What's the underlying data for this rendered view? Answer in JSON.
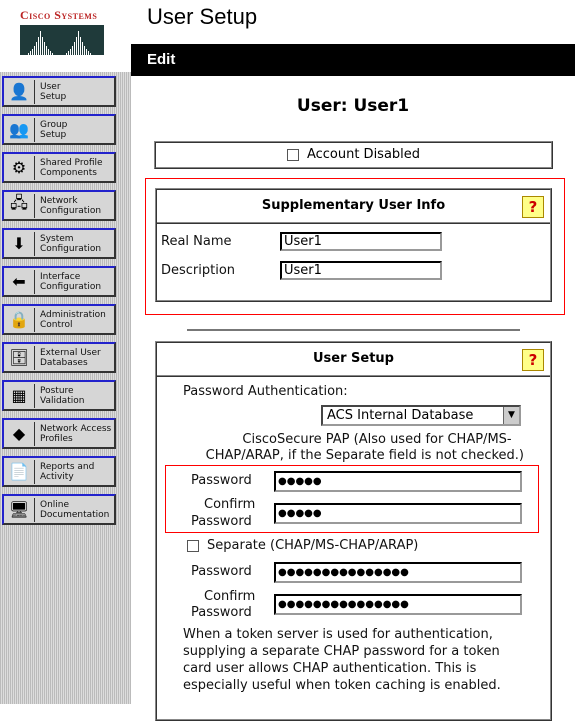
{
  "logo": {
    "text": "Cisco Systems"
  },
  "nav": {
    "items": [
      {
        "label1": "User",
        "label2": "Setup",
        "icon": "user-setup-icon",
        "glyph": "👤"
      },
      {
        "label1": "Group",
        "label2": "Setup",
        "icon": "group-setup-icon",
        "glyph": "👥"
      },
      {
        "label1": "Shared Profile",
        "label2": "Components",
        "icon": "shared-profile-icon",
        "glyph": "⚙"
      },
      {
        "label1": "Network",
        "label2": "Configuration",
        "icon": "network-config-icon",
        "glyph": "🖧"
      },
      {
        "label1": "System",
        "label2": "Configuration",
        "icon": "system-config-icon",
        "glyph": "⬇"
      },
      {
        "label1": "Interface",
        "label2": "Configuration",
        "icon": "interface-config-icon",
        "glyph": "⬅"
      },
      {
        "label1": "Administration",
        "label2": "Control",
        "icon": "admin-control-icon",
        "glyph": "🔒"
      },
      {
        "label1": "External User",
        "label2": "Databases",
        "icon": "external-db-icon",
        "glyph": "🗄"
      },
      {
        "label1": "Posture",
        "label2": "Validation",
        "icon": "posture-icon",
        "glyph": "▦"
      },
      {
        "label1": "Network Access",
        "label2": "Profiles",
        "icon": "nap-icon",
        "glyph": "◆"
      },
      {
        "label1": "Reports and",
        "label2": "Activity",
        "icon": "reports-icon",
        "glyph": "📄"
      },
      {
        "label1": "Online",
        "label2": "Documentation",
        "icon": "docs-icon",
        "glyph": "🖥"
      }
    ]
  },
  "header": {
    "title": "User Setup",
    "edit": "Edit"
  },
  "main": {
    "user_title": "User: User1",
    "account_disabled": "Account Disabled",
    "supp": {
      "title": "Supplementary User Info",
      "real_name_label": "Real Name",
      "real_name": "User1",
      "description_label": "Description",
      "description": "User1"
    },
    "setup": {
      "title": "User Setup",
      "pw_auth_label": "Password Authentication:",
      "pw_auth_value": "ACS Internal Database",
      "pap_line1": "CiscoSecure PAP (Also used for CHAP/MS-",
      "pap_line2": "CHAP/ARAP, if the Separate field is not checked.)",
      "password_label": "Password",
      "confirm_label1": "Confirm",
      "confirm_label2": "Password",
      "password_value": "●●●●●",
      "confirm_value": "●●●●●",
      "separate_label": "Separate (CHAP/MS-CHAP/ARAP)",
      "sep_password_value": "●●●●●●●●●●●●●●●",
      "sep_confirm_value": "●●●●●●●●●●●●●●●",
      "note": [
        "When a token server is used for authentication,",
        "supplying a separate CHAP password for a token",
        "card user allows CHAP authentication. This is",
        "especially useful when token caching is enabled."
      ]
    }
  }
}
